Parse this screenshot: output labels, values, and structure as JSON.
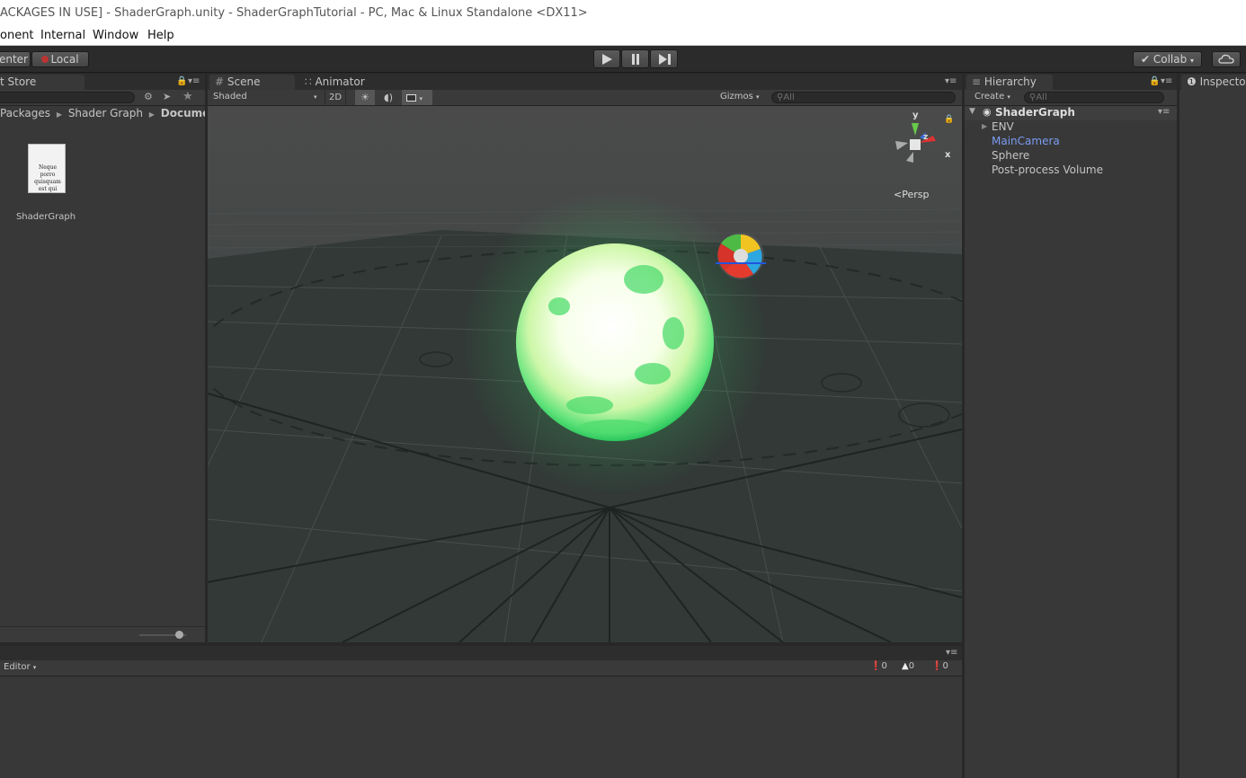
{
  "window": {
    "title": "ACKAGES IN USE] - ShaderGraph.unity - ShaderGraphTutorial - PC, Mac & Linux Standalone <DX11>"
  },
  "menu": [
    "onent",
    "Internal",
    "Window",
    "Help"
  ],
  "toolbar": {
    "pivot_label": "enter",
    "space_label": "Local",
    "play_icon": "play-icon",
    "pause_icon": "pause-icon",
    "step_icon": "step-icon",
    "collab_label": "Collab",
    "cloud_icon": "cloud-icon"
  },
  "project": {
    "tab_label": "t Store",
    "breadcrumb": {
      "part1": "Packages",
      "part2": "Shader Graph",
      "part3": "Documer"
    },
    "asset": {
      "doc_text": "Neque porro quisquam est qui dolorem.",
      "name": "ShaderGraph"
    }
  },
  "scene": {
    "tabs": [
      "Scene",
      "Animator"
    ],
    "shading_mode": "Shaded",
    "mode_2d": "2D",
    "gizmos_label": "Gizmos",
    "search_placeholder": "All",
    "gizmo_labels": {
      "y": "y",
      "z": "z",
      "x": "x"
    },
    "persp_label": "Persp"
  },
  "hierarchy": {
    "tab_label": "Hierarchy",
    "create_label": "Create",
    "search_placeholder": "All",
    "scene_name": "ShaderGraph",
    "items": [
      {
        "label": "ENV",
        "color": "#c4c4c4"
      },
      {
        "label": "MainCamera",
        "color": "#7b9cf0"
      },
      {
        "label": "Sphere",
        "color": "#c4c4c4"
      },
      {
        "label": "Post-process Volume",
        "color": "#c4c4c4"
      }
    ]
  },
  "inspector": {
    "tab_label": "Inspector"
  },
  "console": {
    "editor_label": "Editor",
    "counts": {
      "errors": "0",
      "warnings": "0",
      "logs": "0"
    }
  },
  "colors": {
    "glow": "#3cd96a",
    "selected_item": "#7b9cf0"
  }
}
